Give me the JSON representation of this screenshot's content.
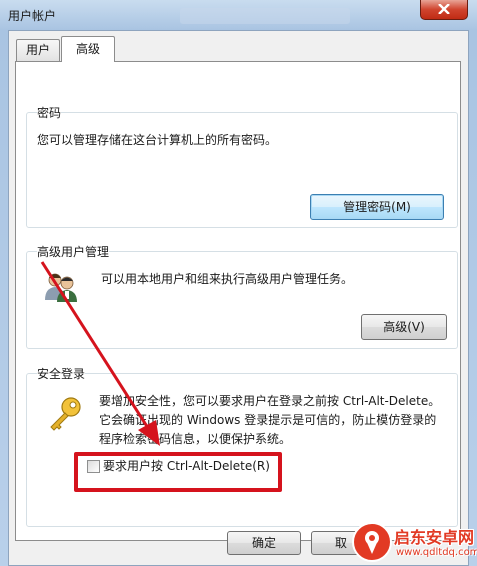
{
  "window": {
    "title": "用户帐户",
    "close_icon": "close-icon"
  },
  "tabs": [
    {
      "label": "用户",
      "selected": false
    },
    {
      "label": "高级",
      "selected": true
    }
  ],
  "passwords": {
    "title": "密码",
    "description": "您可以管理存储在这台计算机上的所有密码。",
    "button": "管理密码(M)"
  },
  "advanced_user_mgmt": {
    "title": "高级用户管理",
    "description": "可以用本地用户和组来执行高级用户管理任务。",
    "button": "高级(V)",
    "icon": "users-icon"
  },
  "secure_logon": {
    "title": "安全登录",
    "line1": "要增加安全性，您可以要求用户在登录之前按 Ctrl-Alt-Delete。",
    "line2": "它会确证出现的 Windows 登录提示是可信的，防止模仿登录的",
    "line3": "程序检索密码信息，以便保护系统。",
    "icon": "key-icon",
    "checkbox_label": "要求用户按 Ctrl-Alt-Delete(R)",
    "checkbox_checked": false
  },
  "footer": {
    "ok": "确定",
    "cancel": "取"
  },
  "annotation": {
    "color": "#d5131d"
  },
  "watermark": {
    "title": "启东安卓网",
    "url": "www.qdltdq.com"
  }
}
